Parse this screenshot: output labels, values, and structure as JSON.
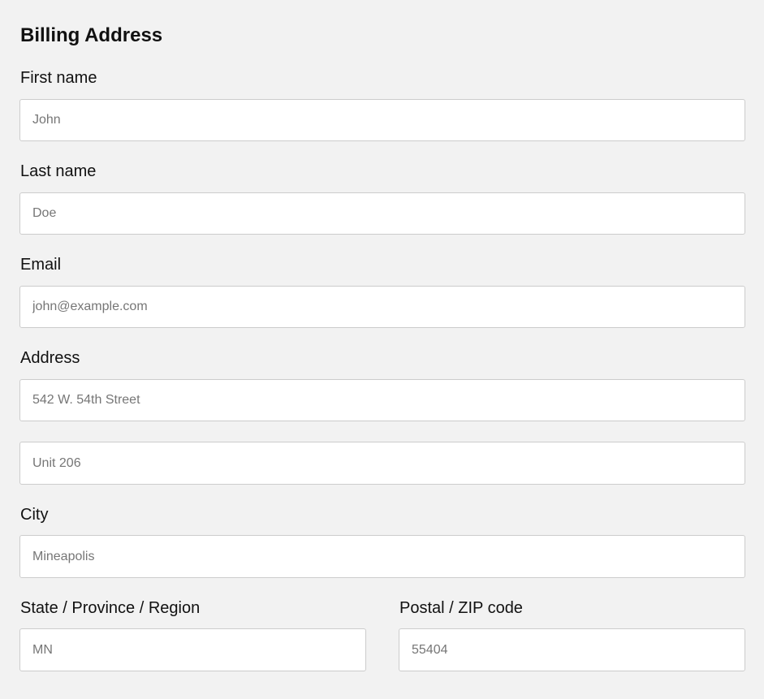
{
  "form": {
    "title": "Billing Address",
    "first_name": {
      "label": "First name",
      "placeholder": "John",
      "value": ""
    },
    "last_name": {
      "label": "Last name",
      "placeholder": "Doe",
      "value": ""
    },
    "email": {
      "label": "Email",
      "placeholder": "john@example.com",
      "value": ""
    },
    "address": {
      "label": "Address",
      "line1_placeholder": "542 W. 54th Street",
      "line2_placeholder": "Unit 206"
    },
    "city": {
      "label": "City",
      "placeholder": "Mineapolis",
      "value": ""
    },
    "state": {
      "label": "State / Province / Region",
      "placeholder": "MN",
      "value": ""
    },
    "postal": {
      "label": "Postal / ZIP code",
      "placeholder": "55404",
      "value": ""
    }
  }
}
